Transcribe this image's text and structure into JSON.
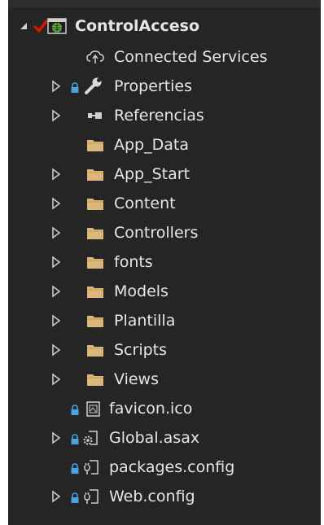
{
  "solution_explorer": {
    "project": {
      "name": "ControlAcceso",
      "expanded": true
    },
    "items": [
      {
        "label": "Connected Services",
        "icon": "connected-services-icon",
        "expandable": false
      },
      {
        "label": "Properties",
        "icon": "wrench-icon",
        "expandable": true,
        "locked": true
      },
      {
        "label": "Referencias",
        "icon": "references-icon",
        "expandable": true
      },
      {
        "label": "App_Data",
        "icon": "folder-icon",
        "expandable": false
      },
      {
        "label": "App_Start",
        "icon": "folder-icon",
        "expandable": true
      },
      {
        "label": "Content",
        "icon": "folder-icon",
        "expandable": true
      },
      {
        "label": "Controllers",
        "icon": "folder-icon",
        "expandable": true
      },
      {
        "label": "fonts",
        "icon": "folder-icon",
        "expandable": true
      },
      {
        "label": "Models",
        "icon": "folder-icon",
        "expandable": true
      },
      {
        "label": "Plantilla",
        "icon": "folder-icon",
        "expandable": true
      },
      {
        "label": "Scripts",
        "icon": "folder-icon",
        "expandable": true
      },
      {
        "label": "Views",
        "icon": "folder-icon",
        "expandable": true
      },
      {
        "label": "favicon.ico",
        "icon": "image-file-icon",
        "expandable": false,
        "locked": true
      },
      {
        "label": "Global.asax",
        "icon": "gear-file-icon",
        "expandable": true,
        "locked": true
      },
      {
        "label": "packages.config",
        "icon": "config-file-icon",
        "expandable": false,
        "locked": true
      },
      {
        "label": "Web.config",
        "icon": "config-file-icon",
        "expandable": true,
        "locked": true
      }
    ]
  },
  "colors": {
    "background": "#252526",
    "text": "#e6e6e6",
    "folder": "#dcb67a",
    "lock": "#4ba3e3",
    "check": "#e51400",
    "globe": "#6ab04c"
  }
}
